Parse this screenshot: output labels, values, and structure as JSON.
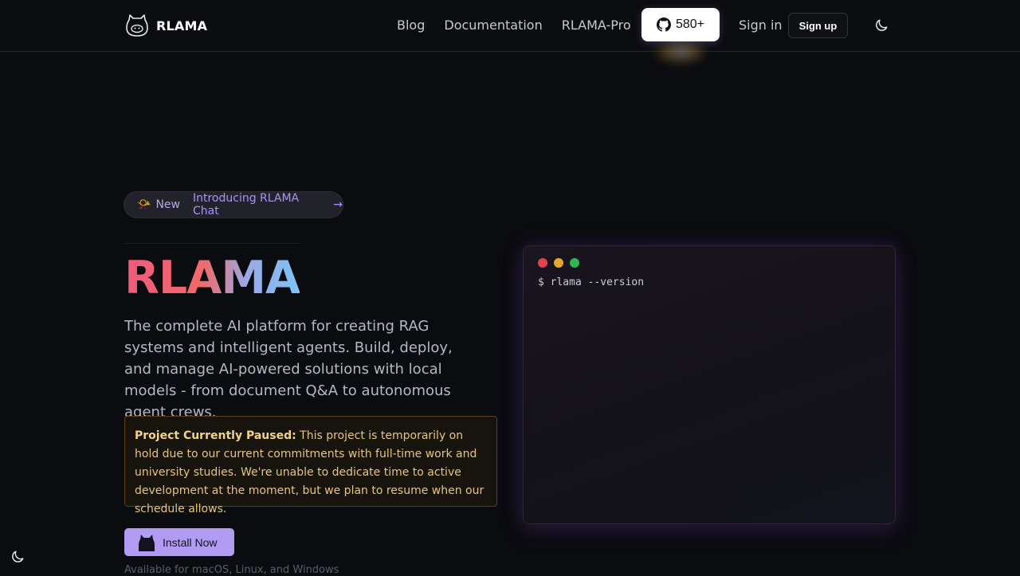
{
  "brand": {
    "name": "RLAMA"
  },
  "nav": {
    "links": [
      {
        "label": "Blog"
      },
      {
        "label": "Documentation"
      },
      {
        "label": "RLAMA-Pro"
      }
    ],
    "github_stars": "580+",
    "sign_in": "Sign in",
    "sign_up": "Sign up"
  },
  "announcement": {
    "emoji": "📯",
    "tag": "New",
    "text": "Introducing RLAMA Chat",
    "arrow": "→"
  },
  "hero": {
    "title": "RLAMA",
    "description": "The complete AI platform for creating RAG systems and intelligent agents. Build, deploy, and manage AI-powered solutions with local models - from document Q&A to autonomous agent crews."
  },
  "notice": {
    "heading": "Project Currently Paused:",
    "body": " This project is temporarily on hold due to our current commitments with full-time work and university studies. We're unable to dedicate time to active development at the moment, but we plan to resume when our schedule allows."
  },
  "cta": {
    "install_label": "Install Now",
    "availability": "Available for macOS, Linux, and Windows"
  },
  "terminal": {
    "command": "$ rlama --version",
    "dot_colors": [
      "#e0434f",
      "#e0a82e",
      "#2fb84f"
    ]
  },
  "colors": {
    "accent": "#b09cf2",
    "background": "#0b0c10",
    "notice_text": "#e7c67a"
  },
  "icons": {
    "logo": "llama-face-icon",
    "github": "github-icon",
    "theme": "moon-icon",
    "install": "llama-icon"
  }
}
